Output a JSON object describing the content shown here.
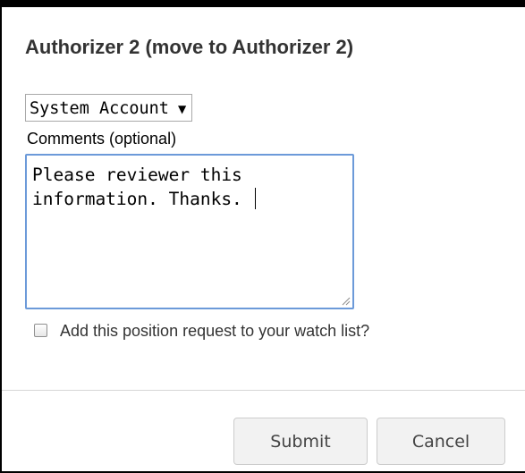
{
  "dialog": {
    "title": "Authorizer 2 (move to Authorizer 2)"
  },
  "account_select": {
    "selected": "System Account",
    "arrow_icon": "triangle-down-icon"
  },
  "comments": {
    "label": "Comments (optional)",
    "value": "Please reviewer this\ninformation. Thanks. "
  },
  "watch_list": {
    "checked": false,
    "label": "Add this position request to your watch list?"
  },
  "footer": {
    "submit_label": "Submit",
    "cancel_label": "Cancel"
  },
  "colors": {
    "focus_border": "#6c9ad9",
    "button_bg": "#f2f2f2",
    "heading_text": "#333333"
  }
}
